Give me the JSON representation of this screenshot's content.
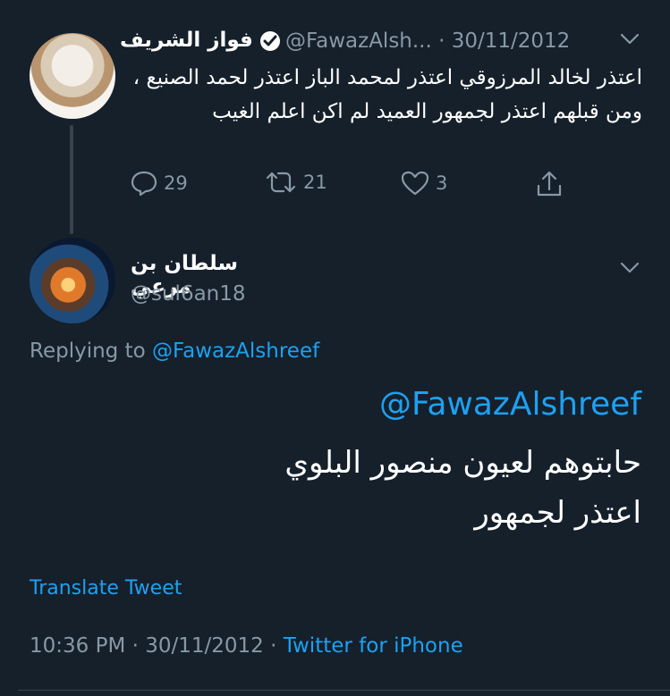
{
  "parent_tweet": {
    "display_name": "فواز الشريف",
    "handle_date": "@FawazAlsh... · 30/11/2012",
    "text": "اعتذر لخالد المرزوقي اعتذر لمحمد الباز اعتذر لحمد الصنيع ، ومن قبلهم اعتذر لجمهور العميد لم اكن اعلم الغيب",
    "reply_count": "29",
    "retweet_count": "21",
    "like_count": "3",
    "icons": [
      "verified-badge-icon",
      "chevron-down-icon",
      "reply-icon",
      "retweet-icon",
      "like-icon",
      "share-icon"
    ]
  },
  "reply_tweet": {
    "display_name": "سلطان بن مرعي",
    "handle": "@sul6an18",
    "replying_prefix": "Replying to ",
    "replying_to": "@FawazAlshreef",
    "mention": "@FawazAlshreef",
    "text_line1": "حابتوهم لعيون منصور البلوي",
    "text_line2": "اعتذر لجمهور",
    "translate_label": "Translate Tweet",
    "timestamp": "10:36 PM · 30/11/2012 · ",
    "source": "Twitter for iPhone",
    "icons": [
      "chevron-down-icon"
    ]
  },
  "colors": {
    "background": "#15202b",
    "accent": "#1da1f2",
    "secondary_text": "#8899a6",
    "divider": "#38444d"
  }
}
